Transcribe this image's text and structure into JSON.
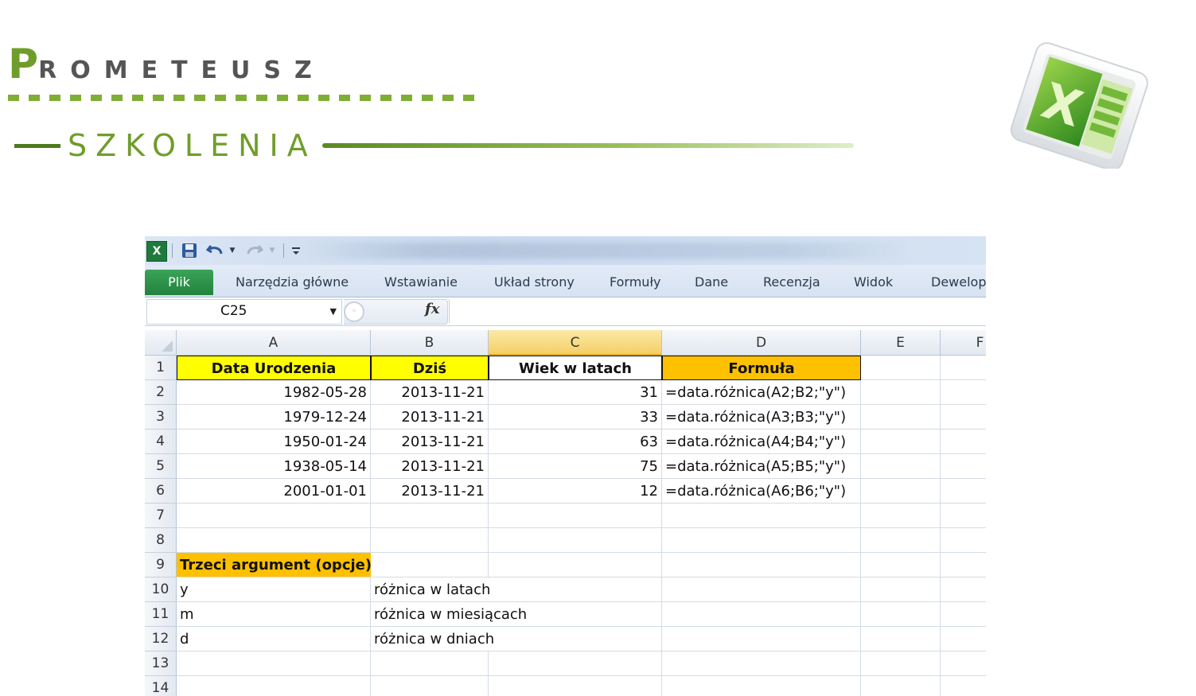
{
  "brand": {
    "logo_first": "P",
    "logo_rest": "ROMETEUSZ",
    "subtitle": "SZKOLENIA"
  },
  "excel_icon": "excel-app-icon",
  "window": {
    "qat": {
      "app_icon": "X",
      "icons": [
        "excel-icon",
        "save-icon",
        "undo-icon",
        "redo-icon",
        "customize-qat-icon"
      ]
    },
    "tabs": [
      "Plik",
      "Narzędzia główne",
      "Wstawianie",
      "Układ strony",
      "Formuły",
      "Dane",
      "Recenzja",
      "Widok",
      "Dewelop"
    ],
    "formula_bar": {
      "name_box": "C25",
      "fx_label": "fx",
      "formula": ""
    }
  },
  "sheet": {
    "columns": [
      "A",
      "B",
      "C",
      "D",
      "E",
      "F"
    ],
    "selected_column": "C",
    "rows": [
      {
        "n": "1",
        "A": "Data Urodzenia",
        "B": "Dziś",
        "C": "Wiek w latach",
        "D": "Formuła"
      },
      {
        "n": "2",
        "A": "1982-05-28",
        "B": "2013-11-21",
        "C": "31",
        "D": "=data.różnica(A2;B2;\"y\")"
      },
      {
        "n": "3",
        "A": "1979-12-24",
        "B": "2013-11-21",
        "C": "33",
        "D": "=data.różnica(A3;B3;\"y\")"
      },
      {
        "n": "4",
        "A": "1950-01-24",
        "B": "2013-11-21",
        "C": "63",
        "D": "=data.różnica(A4;B4;\"y\")"
      },
      {
        "n": "5",
        "A": "1938-05-14",
        "B": "2013-11-21",
        "C": "75",
        "D": "=data.różnica(A5;B5;\"y\")"
      },
      {
        "n": "6",
        "A": "2001-01-01",
        "B": "2013-11-21",
        "C": "12",
        "D": "=data.różnica(A6;B6;\"y\")"
      },
      {
        "n": "7",
        "A": "",
        "B": "",
        "C": "",
        "D": ""
      },
      {
        "n": "8",
        "A": "",
        "B": "",
        "C": "",
        "D": ""
      },
      {
        "n": "9",
        "A": "Trzeci argument (opcje)",
        "B": "",
        "C": "",
        "D": ""
      },
      {
        "n": "10",
        "A": "y",
        "B": "różnica w latach",
        "C": "",
        "D": ""
      },
      {
        "n": "11",
        "A": "m",
        "B": "różnica w miesiącach",
        "C": "",
        "D": ""
      },
      {
        "n": "12",
        "A": "d",
        "B": "różnica w dniach",
        "C": "",
        "D": ""
      },
      {
        "n": "13",
        "A": "",
        "B": "",
        "C": "",
        "D": ""
      },
      {
        "n": "14",
        "A": "",
        "B": "",
        "C": "",
        "D": ""
      }
    ]
  },
  "colors": {
    "brand_green": "#6f9d2b",
    "header_yellow": "#ffff00",
    "header_orange": "#ffc000",
    "file_tab_green": "#23823d"
  }
}
